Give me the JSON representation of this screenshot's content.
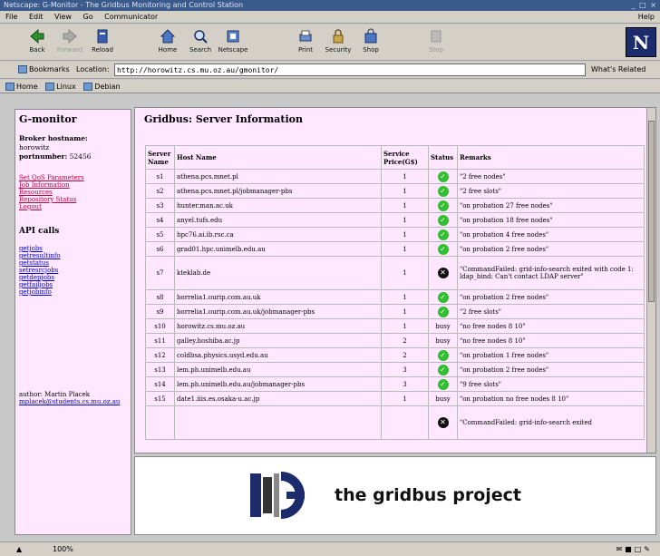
{
  "window": {
    "title": "Netscape: G-Monitor - The Gridbus Monitoring and Control Station",
    "controls": "_ □ ×"
  },
  "menu": {
    "items": [
      "File",
      "Edit",
      "View",
      "Go",
      "Communicator"
    ],
    "help": "Help"
  },
  "toolbar": {
    "back": "Back",
    "forward": "Forward",
    "reload": "Reload",
    "home": "Home",
    "search": "Search",
    "netscape": "Netscape",
    "print": "Print",
    "security": "Security",
    "shop": "Shop",
    "stop": "Stop",
    "logo": "N"
  },
  "location": {
    "bookmarks": "Bookmarks",
    "label": "Location:",
    "url": "http://horowitz.cs.mu.oz.au/gmonitor/",
    "whats_related": "What's Related"
  },
  "personal": {
    "items": [
      "Home",
      "Linux",
      "Debian"
    ]
  },
  "left": {
    "title": "G-monitor",
    "broker_label": "Broker hostname:",
    "broker_host": "horowitz",
    "port_label": "portnumber:",
    "port": "52456",
    "links": [
      "Set QoS Parameters",
      "Job Information",
      "Resources",
      "Repository Status",
      "Logout"
    ],
    "api_title": "API calls",
    "api_links": [
      "getjobs",
      "getresultinfo",
      "getstatus",
      "setresrcjobs",
      "getdepjobs",
      "getfailjobs",
      "getjobinfo"
    ],
    "author_label": "author: Martin Placek",
    "author_email": "mplacek@students.cs.mu.oz.au"
  },
  "main": {
    "title": "Gridbus: Server Information",
    "columns": [
      "Server Name",
      "Host Name",
      "Service Price(G$)",
      "Status",
      "Remarks"
    ],
    "rows": [
      {
        "name": "s1",
        "host": "athena.pcs.mnet.pl",
        "price": "1",
        "status": "ok",
        "remarks": "\"2 free nodes\""
      },
      {
        "name": "s2",
        "host": "athena.pcs.mnet.pl/jobmanager-pbs",
        "price": "1",
        "status": "ok",
        "remarks": "\"2 free slots\""
      },
      {
        "name": "s3",
        "host": "hunter.man.ac.uk",
        "price": "1",
        "status": "ok",
        "remarks": "\"on probation 27 free nodes\""
      },
      {
        "name": "s4",
        "host": "anyel.tufs.edu",
        "price": "1",
        "status": "ok",
        "remarks": "\"on probation 18 free nodes\""
      },
      {
        "name": "s5",
        "host": "hpc76.ai.ib.rsc.ca",
        "price": "1",
        "status": "ok",
        "remarks": "\"on probation 4 free nodes\""
      },
      {
        "name": "s6",
        "host": "grad01.hpc.unimelb.edu.au",
        "price": "1",
        "status": "ok",
        "remarks": "\"on probation 2 free nodes\""
      },
      {
        "name": "s7",
        "host": "kteklab.de",
        "price": "1",
        "status": "bad",
        "remarks": "\"CommandFailed: grid-info-search exited with code 1: ldap_bind: Can't contact LDAP server\"",
        "tall": true
      },
      {
        "name": "s8",
        "host": "borrelia1.ourip.com.au.uk",
        "price": "1",
        "status": "ok",
        "remarks": "\"on probation 2 free nodes\""
      },
      {
        "name": "s9",
        "host": "borrelia1.ourip.com.au.uk/jobmanager-pbs",
        "price": "1",
        "status": "ok",
        "remarks": "\"2 free slots\""
      },
      {
        "name": "s10",
        "host": "horowitz.cs.mu.oz.au",
        "price": "1",
        "status": "busy",
        "remarks": "\"no free nodes 8 10\""
      },
      {
        "name": "s11",
        "host": "galley.hoshiba.ac.jp",
        "price": "2",
        "status": "busy",
        "remarks": "\"no free nodes 8 10\""
      },
      {
        "name": "s12",
        "host": "coldbsa.physics.usyd.edu.au",
        "price": "2",
        "status": "ok",
        "remarks": "\"on probation 1 free nodes\""
      },
      {
        "name": "s13",
        "host": "lem.ph.unimelb.edu.au",
        "price": "3",
        "status": "ok",
        "remarks": "\"on probation 2 free nodes\""
      },
      {
        "name": "s14",
        "host": "lem.ph.unimelb.edu.au/jobmanager-pbs",
        "price": "3",
        "status": "ok",
        "remarks": "\"9 free slots\""
      },
      {
        "name": "s15",
        "host": "date1.iiis.es.osaka-u.ac.jp",
        "price": "1",
        "status": "busy",
        "remarks": "\"on probation no free nodes 8 10\""
      },
      {
        "name": "",
        "host": "",
        "price": "",
        "status": "bad",
        "remarks": "\"CommandFailed: grid-info-search exited",
        "tall": true
      }
    ],
    "busy_text": "busy"
  },
  "footer": {
    "logo_text": "the gridbus project"
  },
  "status": {
    "percent": "100%"
  },
  "colors": {
    "frame_bg": "#ffe8ff",
    "ok": "#2fbf2f",
    "link_red": "#c0003a",
    "link_blue": "#0000c8"
  }
}
